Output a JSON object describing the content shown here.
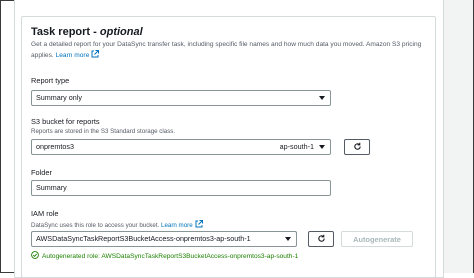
{
  "section": {
    "title": "Task report - ",
    "title_optional": "optional",
    "description": "Get a detailed report for your DataSync transfer task, including specific file names and how much data you moved. Amazon S3 pricing applies.",
    "learn_more": "Learn more"
  },
  "report_type": {
    "label": "Report type",
    "value": "Summary only"
  },
  "s3_bucket": {
    "label": "S3 bucket for reports",
    "sublabel": "Reports are stored in the S3 Standard storage class.",
    "value": "onpremtos3",
    "region": "ap-south-1"
  },
  "folder": {
    "label": "Folder",
    "value": "Summary"
  },
  "iam_role": {
    "label": "IAM role",
    "sublabel": "DataSync uses this role to access your bucket.",
    "learn_more": "Learn more",
    "value": "AWSDataSyncTaskReportS3BucketAccess-onpremtos3-ap-south-1",
    "autogenerate_label": "Autogenerate",
    "status_text": "Autogenerated role: AWSDataSyncTaskReportS3BucketAccess-onpremtos3-ap-south-1"
  },
  "colors": {
    "link": "#0073bb",
    "success": "#1d8102",
    "border": "#879596"
  },
  "icons": [
    "external-link-icon",
    "chevron-down-icon",
    "refresh-icon",
    "check-circle-icon"
  ]
}
